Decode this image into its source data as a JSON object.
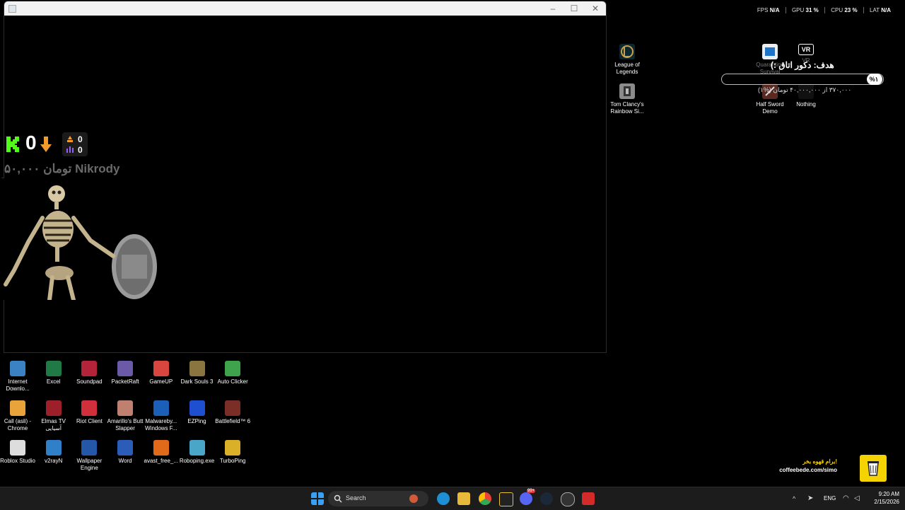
{
  "stats": {
    "fps_label": "FPS",
    "fps": "N/A",
    "gpu_label": "GPU",
    "gpu": "31 %",
    "cpu_label": "CPU",
    "cpu": "23 %",
    "lat_label": "LAT",
    "lat": "N/A"
  },
  "overlay": {
    "kick_count": "0",
    "stat_top": "0",
    "stat_bottom": "0",
    "donor_line": "۵۰,۰۰۰ تومان Nikrody",
    "tiny": "C"
  },
  "goal": {
    "title": "هدف: دکور اتاق :)",
    "percent": "%۱",
    "percent_value": 0.01,
    "subtitle": "۳۷۰,۰۰۰ از ۴۰,۰۰۰,۰۰۰ تومان (%۱)"
  },
  "desktop_right": [
    {
      "label": "League of Legends",
      "icon": "league-of-legends-icon"
    },
    {
      "label": "Tom Clancy's Rainbow Si...",
      "icon": "rainbow-six-icon"
    },
    {
      "label": "Quarantine Survival",
      "icon": "quarantine-icon"
    },
    {
      "label": "VR",
      "icon": "vr-icon"
    },
    {
      "label": "Half Sword Demo",
      "icon": "half-sword-icon"
    },
    {
      "label": "Nothing",
      "icon": "nothing-icon"
    }
  ],
  "desktop_bottom": [
    {
      "label": "Internet Downlo...",
      "icon": "internet-download-icon",
      "color": "#3b82c4"
    },
    {
      "label": "Excel",
      "icon": "excel-icon",
      "color": "#1f7a46"
    },
    {
      "label": "Soundpad",
      "icon": "soundpad-icon",
      "color": "#b3243a"
    },
    {
      "label": "PacketRaft",
      "icon": "packetraft-icon",
      "color": "#6a5aa8"
    },
    {
      "label": "GameUP",
      "icon": "gameup-icon",
      "color": "#d8463f"
    },
    {
      "label": "Dark Souls 3",
      "icon": "dark-souls-icon",
      "color": "#8a7440"
    },
    {
      "label": "Auto Clicker",
      "icon": "auto-clicker-icon",
      "color": "#3fa34d"
    },
    {
      "label": "Call (asli) - Chrome",
      "icon": "chrome-icon",
      "color": "#e8a33a"
    },
    {
      "label": "Elmas TV آسیایی",
      "icon": "elmas-tv-icon",
      "color": "#9c1f2a"
    },
    {
      "label": "Riot Client",
      "icon": "riot-client-icon",
      "color": "#d0303b"
    },
    {
      "label": "Amarillo's Butt Slapper",
      "icon": "amarillo-icon",
      "color": "#c08070"
    },
    {
      "label": "Malwareby... Windows F...",
      "icon": "malwarebytes-icon",
      "color": "#1b5fb6"
    },
    {
      "label": "EZPing",
      "icon": "ezping-icon",
      "color": "#1e4fd0"
    },
    {
      "label": "Battlefield™ 6",
      "icon": "battlefield-icon",
      "color": "#7a2e26"
    },
    {
      "label": "Roblox Studio",
      "icon": "roblox-icon",
      "color": "#dddddd"
    },
    {
      "label": "v2rayN",
      "icon": "v2rayn-icon",
      "color": "#2f7fc9"
    },
    {
      "label": "Wallpaper Engine",
      "icon": "wallpaper-engine-icon",
      "color": "#2457a8"
    },
    {
      "label": "Word",
      "icon": "word-icon",
      "color": "#2b5cb8"
    },
    {
      "label": "avast_free_...",
      "icon": "avast-icon",
      "color": "#e06a1a"
    },
    {
      "label": "Roboping.exe",
      "icon": "roboping-icon",
      "color": "#4aa6c9"
    },
    {
      "label": "TurboPing",
      "icon": "turboping-icon",
      "color": "#d9b027"
    }
  ],
  "coffee": {
    "title": "برام قهوه بخر!",
    "url": "coffeebede.com/simo"
  },
  "taskbar": {
    "search_placeholder": "Search",
    "lang": "ENG",
    "time": "9:20 AM",
    "date": "2/15/2026",
    "discord_badge": "99+"
  }
}
